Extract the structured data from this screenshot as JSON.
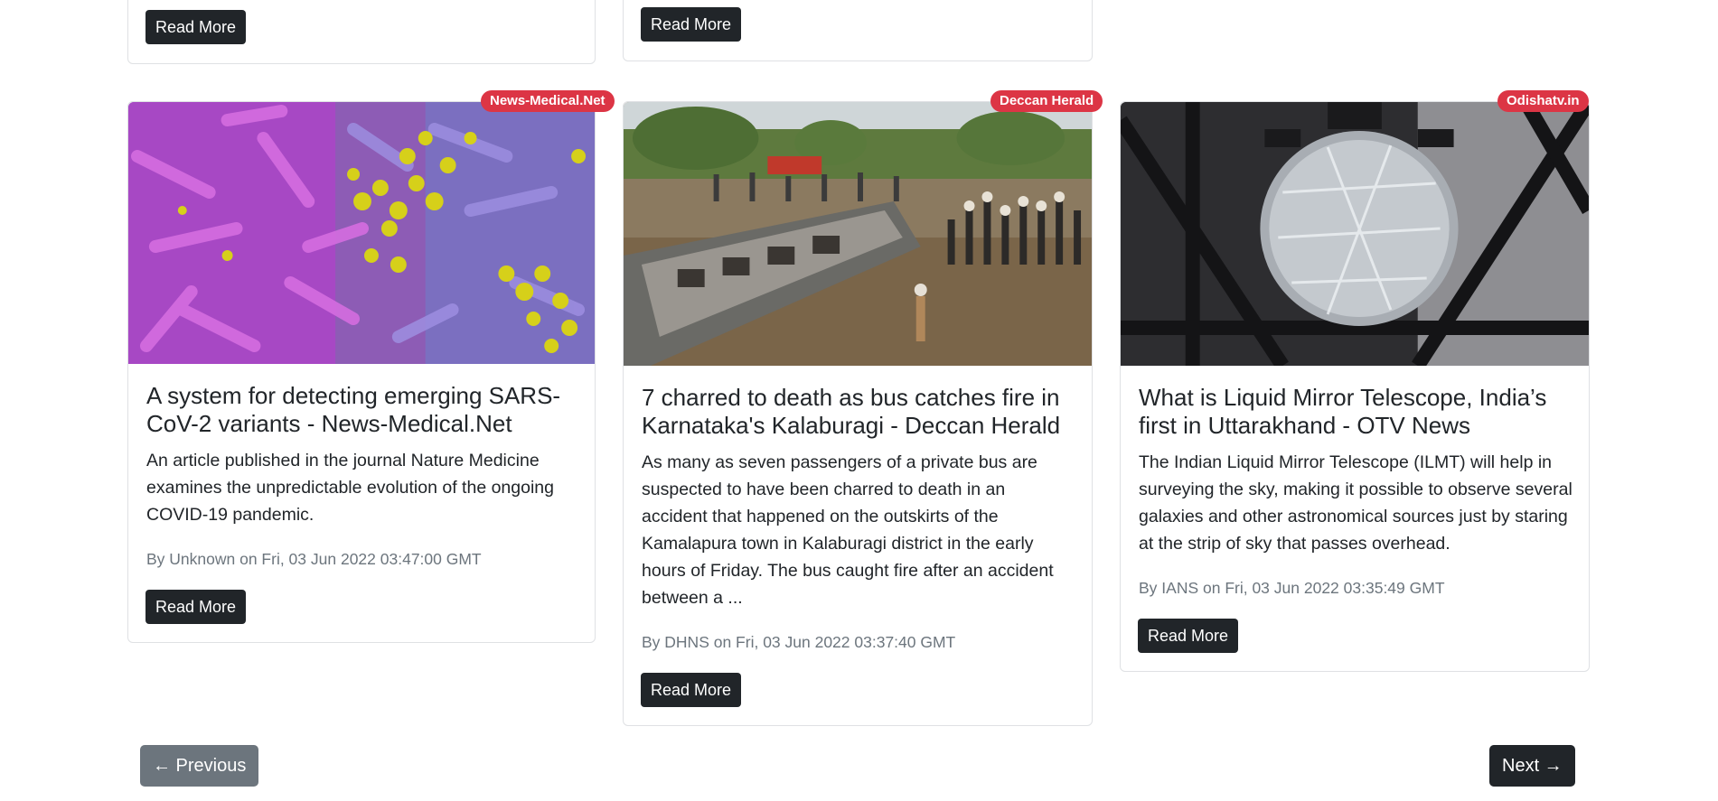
{
  "top_row": {
    "read_more_label": "Read More"
  },
  "cards": [
    {
      "source": "News-Medical.Net",
      "title": "A system for detecting emerging SARS-CoV-2 variants - News-Medical.Net",
      "description": "An article published in the journal Nature Medicine examines the unpredictable evolution of the ongoing COVID-19 pandemic.",
      "meta": "By Unknown on Fri, 03 Jun 2022 03:47:00 GMT",
      "read_more_label": "Read More"
    },
    {
      "source": "Deccan Herald",
      "title": "7 charred to death as bus catches fire in Karnataka's Kalaburagi - Deccan Herald",
      "description": "As many as seven passengers of a private bus are suspected to have been charred to death in an accident that happened on the outskirts of the Kamalapura town in Kalaburagi district in the early hours of Friday. The bus caught fire after an accident between a ...",
      "meta": "By DHNS on Fri, 03 Jun 2022 03:37:40 GMT",
      "read_more_label": "Read More"
    },
    {
      "source": "Odishatv.in",
      "title": "What is Liquid Mirror Telescope, India’s first in Uttarakhand - OTV News",
      "description": "The Indian Liquid Mirror Telescope (ILMT) will help in surveying the sky, making it possible to observe several galaxies and other astronomical sources just by staring at the strip of sky that passes overhead.",
      "meta": "By IANS on Fri, 03 Jun 2022 03:35:49 GMT",
      "read_more_label": "Read More"
    }
  ],
  "pagination": {
    "previous_label": "← Previous",
    "next_label": "Next →"
  },
  "colors": {
    "badge": "#dc3545",
    "button_dark": "#212529",
    "button_disabled": "#6c757d",
    "meta_text": "#6c757d"
  }
}
